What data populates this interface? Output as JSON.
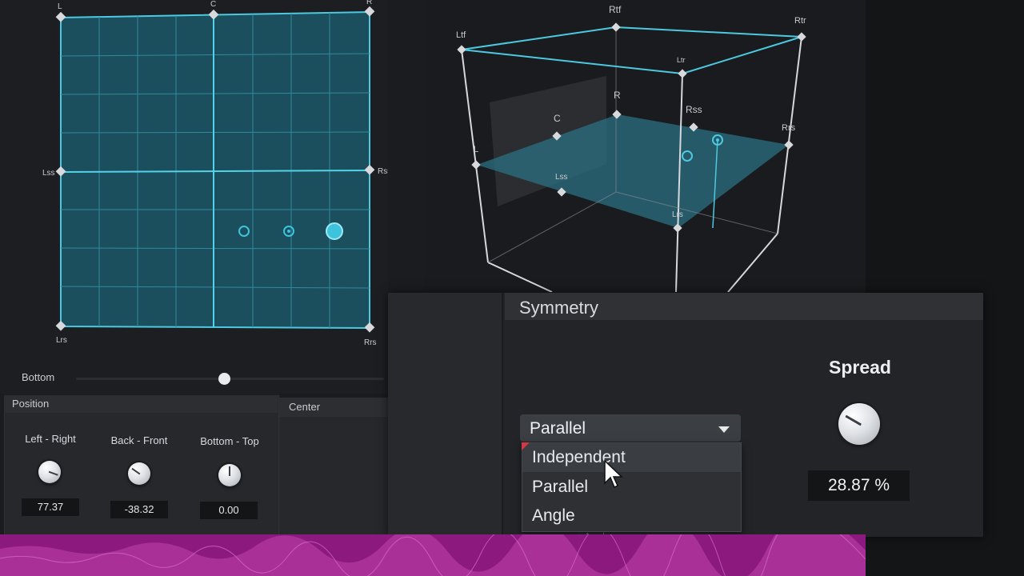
{
  "panner2d": {
    "speakers": {
      "top_left": "L",
      "top_center": "C",
      "top_right": "R",
      "mid_left": "Lss",
      "mid_right": "Rss",
      "bottom_left": "Lrs",
      "bottom_right": "Rrs"
    }
  },
  "view3d": {
    "labels": {
      "ltf": "Ltf",
      "rtf": "Rtf",
      "rtr": "Rtr",
      "ltr": "Ltr",
      "r": "R",
      "c": "C",
      "rss": "Rss",
      "rrs": "Rrs",
      "l": "L",
      "lss": "Lss",
      "lrs": "Lrs"
    }
  },
  "bottom_slider": {
    "label": "Bottom"
  },
  "position": {
    "title": "Position",
    "knobs": [
      {
        "label": "Left - Right",
        "value": "77.37"
      },
      {
        "label": "Back - Front",
        "value": "-38.32"
      },
      {
        "label": "Bottom - Top",
        "value": "0.00"
      }
    ]
  },
  "center": {
    "title": "Center"
  },
  "symmetry": {
    "title": "Symmetry",
    "mode_selected": "Parallel",
    "options": [
      "Independent",
      "Parallel",
      "Angle"
    ],
    "behind_label": "Angle",
    "spread_label": "Spread",
    "spread_value": "28.87 %"
  },
  "colors": {
    "grid_fill": "#1b4f5e",
    "grid_line": "#4cc9e0",
    "accent": "#2ab0cc",
    "waveform": "#a0228f"
  }
}
